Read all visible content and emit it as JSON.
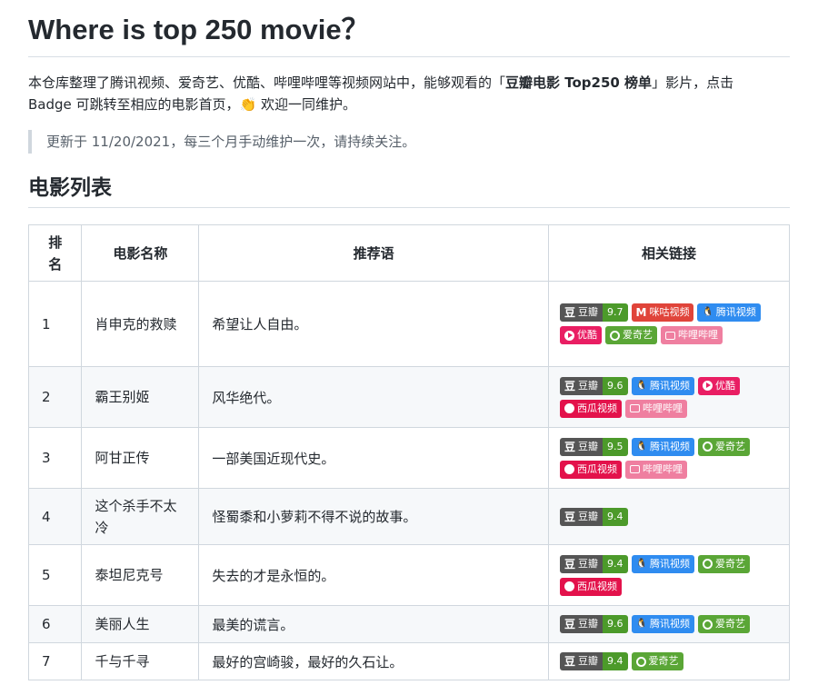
{
  "page": {
    "title": "Where is top 250 movie？",
    "intro_before": "本仓库整理了腾讯视频、爱奇艺、优酷、哔哩哔哩等视频网站中，能够观看的「",
    "intro_bold": "豆瓣电影 Top250 榜单",
    "intro_after": "」影片，点击",
    "intro_line2_before": "Badge 可跳转至相应的电影首页，",
    "intro_emoji": "👏",
    "intro_line2_after": " 欢迎一同维护。",
    "quote": "更新于 11/20/2021，每三个月手动维护一次，请持续关注。",
    "section_title": "电影列表"
  },
  "table": {
    "headers": [
      "排名",
      "电影名称",
      "推荐语",
      "相关链接"
    ],
    "rows": [
      {
        "rank": "1",
        "name": "肖申克的救赎",
        "quote": "希望让人自由。",
        "badges": [
          {
            "type": "douban",
            "label": "豆瓣",
            "score": "9.7"
          },
          {
            "type": "migu",
            "label": "咪咕视频"
          },
          {
            "type": "tencent",
            "label": "腾讯视频"
          },
          {
            "type": "youku",
            "label": "优酷"
          },
          {
            "type": "iqiyi",
            "label": "爱奇艺"
          },
          {
            "type": "bilibili",
            "label": "哔哩哔哩"
          }
        ]
      },
      {
        "rank": "2",
        "name": "霸王别姬",
        "quote": "风华绝代。",
        "badges": [
          {
            "type": "douban",
            "label": "豆瓣",
            "score": "9.6"
          },
          {
            "type": "tencent",
            "label": "腾讯视频"
          },
          {
            "type": "youku",
            "label": "优酷"
          },
          {
            "type": "xigua",
            "label": "西瓜视频"
          },
          {
            "type": "bilibili",
            "label": "哔哩哔哩"
          }
        ]
      },
      {
        "rank": "3",
        "name": "阿甘正传",
        "quote": "一部美国近现代史。",
        "badges": [
          {
            "type": "douban",
            "label": "豆瓣",
            "score": "9.5"
          },
          {
            "type": "tencent",
            "label": "腾讯视频"
          },
          {
            "type": "iqiyi",
            "label": "爱奇艺"
          },
          {
            "type": "xigua",
            "label": "西瓜视频"
          },
          {
            "type": "bilibili",
            "label": "哔哩哔哩"
          }
        ]
      },
      {
        "rank": "4",
        "name": "这个杀手不太冷",
        "quote": "怪蜀黍和小萝莉不得不说的故事。",
        "badges": [
          {
            "type": "douban",
            "label": "豆瓣",
            "score": "9.4"
          }
        ]
      },
      {
        "rank": "5",
        "name": "泰坦尼克号",
        "quote": "失去的才是永恒的。",
        "badges": [
          {
            "type": "douban",
            "label": "豆瓣",
            "score": "9.4"
          },
          {
            "type": "tencent",
            "label": "腾讯视频"
          },
          {
            "type": "iqiyi",
            "label": "爱奇艺"
          },
          {
            "type": "xigua",
            "label": "西瓜视频"
          }
        ]
      },
      {
        "rank": "6",
        "name": "美丽人生",
        "quote": "最美的谎言。",
        "badges": [
          {
            "type": "douban",
            "label": "豆瓣",
            "score": "9.6"
          },
          {
            "type": "tencent",
            "label": "腾讯视频"
          },
          {
            "type": "iqiyi",
            "label": "爱奇艺"
          }
        ]
      },
      {
        "rank": "7",
        "name": "千与千寻",
        "quote": "最好的宫崎骏，最好的久石让。",
        "badges": [
          {
            "type": "douban",
            "label": "豆瓣",
            "score": "9.4"
          },
          {
            "type": "iqiyi",
            "label": "爱奇艺"
          }
        ]
      }
    ]
  },
  "badge_styles": {
    "douban": {
      "color": "#555555",
      "score_color": "#4c9a2a",
      "icon": "dou-glyph-icon",
      "glyph": "豆"
    },
    "migu": {
      "color": "#e0443a",
      "icon": "migu-m-icon",
      "glyph": "M"
    },
    "tencent": {
      "color": "#2f8cf0",
      "icon": "penguin-icon",
      "glyph": "🐧"
    },
    "youku": {
      "color": "#e91e63",
      "icon": "play-circle-icon"
    },
    "iqiyi": {
      "color": "#5aa636",
      "icon": "iqiyi-q-icon"
    },
    "bilibili": {
      "color": "#ef7fa0",
      "icon": "tv-icon"
    },
    "xigua": {
      "color": "#e3124b",
      "icon": "watermelon-icon"
    }
  }
}
